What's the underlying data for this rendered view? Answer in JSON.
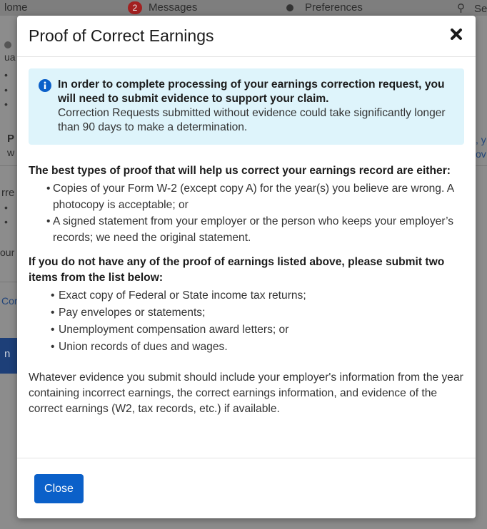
{
  "background": {
    "nav_left": "lome",
    "messages_count": "2",
    "messages_label": "Messages",
    "preferences_label": "Preferences",
    "search_label": "Se",
    "frag_ua": "ua",
    "frag_p": "P",
    "frag_w": "w",
    "frag_rre": "rre",
    "frag_our": "our",
    "frag_cor": "Cor",
    "frag_n": "n",
    "frag_right_y": ", y",
    "frag_right_ov": "ov"
  },
  "modal": {
    "title": "Proof of Correct Earnings",
    "alert": {
      "bold": "In order to complete processing of your earnings correction request, you will need to submit evidence to support your claim.",
      "text": "Correction Requests submitted without evidence could take significantly longer than 90 days to make a determination."
    },
    "best_proof": {
      "heading": "The best types of proof  that will help us correct your earnings record are either:",
      "items": [
        "Copies of your Form W-2 (except copy A) for the year(s) you believe are wrong. A photocopy is acceptable; or",
        "A signed statement from your employer or the person who keeps your employer’s records; we need the original statement."
      ]
    },
    "alternative": {
      "heading": "If you do not have any of the proof of earnings listed above, please submit two items from the list below:",
      "items": [
        "Exact copy of Federal or State income tax returns;",
        "Pay envelopes or statements;",
        "Unemployment compensation award letters; or",
        "Union records of dues and wages."
      ]
    },
    "closing_text": "Whatever evidence you submit should include your employer's information from the year containing incorrect earnings, the correct earnings information, and evidence of the correct earnings (W2, tax records, etc.) if available.",
    "close_button_label": "Close"
  },
  "colors": {
    "primary_button": "#0b60c9",
    "alert_background": "#def4fb",
    "info_icon": "#0b60c9"
  }
}
